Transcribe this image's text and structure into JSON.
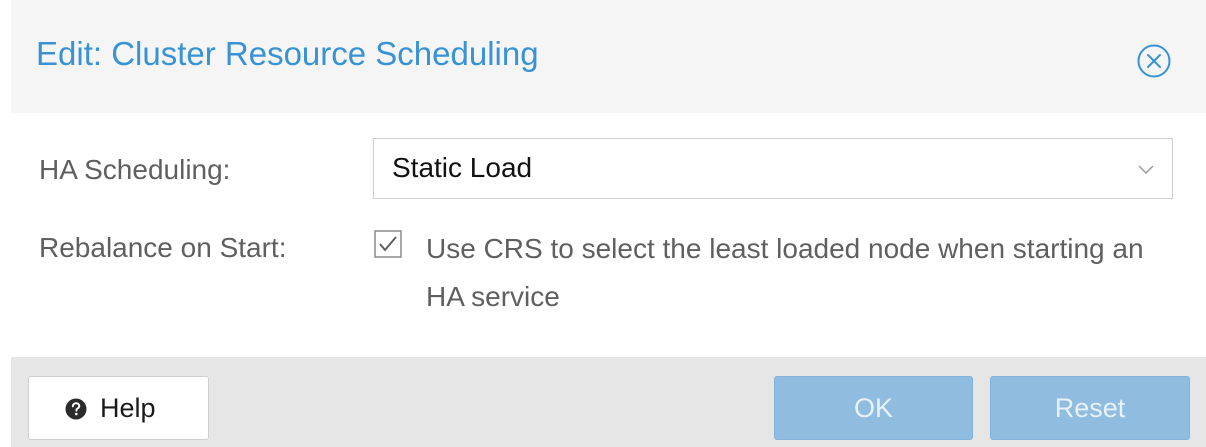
{
  "dialog": {
    "title": "Edit: Cluster Resource Scheduling",
    "close_icon": "circle-x-icon"
  },
  "form": {
    "ha_scheduling": {
      "label": "HA Scheduling:",
      "value": "Static Load",
      "dropdown_icon": "chevron-down-icon"
    },
    "rebalance": {
      "label": "Rebalance on Start:",
      "checked": true,
      "text": "Use CRS to select the least loaded node when starting an HA service"
    }
  },
  "footer": {
    "help_label": "Help",
    "help_icon": "question-circle-icon",
    "ok_label": "OK",
    "reset_label": "Reset"
  },
  "colors": {
    "title": "#3892d3",
    "primary_button_disabled": "#8fbcdf",
    "header_bg": "#f5f5f5",
    "footer_bg": "#e6e6e6"
  }
}
